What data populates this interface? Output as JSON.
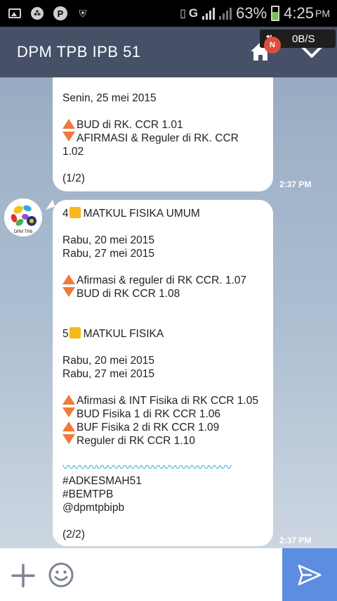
{
  "status_bar": {
    "battery_percent": "63%",
    "time": "4:25",
    "ampm": "PM",
    "network": "G",
    "icons": [
      "gallery-icon",
      "bbm-icon",
      "p-icon",
      "shield-icon",
      "vibrate-icon",
      "signal-icon",
      "battery-icon"
    ]
  },
  "header": {
    "title": "DPM TPB IPB 51",
    "speed": "0B/S",
    "badge": "N"
  },
  "messages": [
    {
      "lines": [
        {
          "text": "Senin, 25 mei 2015"
        },
        {
          "text": ""
        },
        {
          "icon": "up",
          "text": "BUD di RK. CCR 1.01"
        },
        {
          "icon": "down",
          "text": "AFIRMASI & Reguler di RK. CCR"
        },
        {
          "text": "1.02"
        },
        {
          "text": ""
        },
        {
          "text": "(1/2)"
        }
      ],
      "time": "2:37 PM"
    },
    {
      "avatar_text": "DPM TPB",
      "lines": [
        {
          "num": "4",
          "text": "MATKUL FISIKA UMUM"
        },
        {
          "text": ""
        },
        {
          "text": "Rabu, 20 mei 2015"
        },
        {
          "text": "Rabu, 27 mei 2015"
        },
        {
          "text": ""
        },
        {
          "icon": "up",
          "text": "Afirmasi & reguler di RK CCR. 1.07"
        },
        {
          "icon": "down",
          "text": "BUD di RK CCR 1.08"
        },
        {
          "text": ""
        },
        {
          "text": ""
        },
        {
          "num": "5",
          "text": "MATKUL FISIKA"
        },
        {
          "text": ""
        },
        {
          "text": "Rabu, 20 mei 2015"
        },
        {
          "text": "Rabu, 27 mei 2015"
        },
        {
          "text": ""
        },
        {
          "icon": "up",
          "text": "Afirmasi & INT Fisika di RK CCR 1.05"
        },
        {
          "icon": "down",
          "text": "BUD Fisika 1 di RK CCR 1.06"
        },
        {
          "icon": "up",
          "text": "BUF Fisika 2 di RK CCR 1.09"
        },
        {
          "icon": "down",
          "text": "Reguler di RK CCR 1.10"
        },
        {
          "text": ""
        },
        {
          "wave": "〰〰〰〰〰〰〰〰〰〰〰〰〰〰〰"
        },
        {
          "text": "#ADKESMAH51"
        },
        {
          "text": "#BEMTPB"
        },
        {
          "text": "@dpmtpbipb"
        },
        {
          "text": ""
        },
        {
          "text": "(2/2)"
        }
      ],
      "time": "2:37 PM"
    }
  ],
  "colors": {
    "header_bg": "#465168",
    "send_bg": "#5c8de0",
    "arrow_orange": "#ef7a3b",
    "square_yellow": "#f6b81a",
    "wave_blue": "#2cb1d8"
  }
}
